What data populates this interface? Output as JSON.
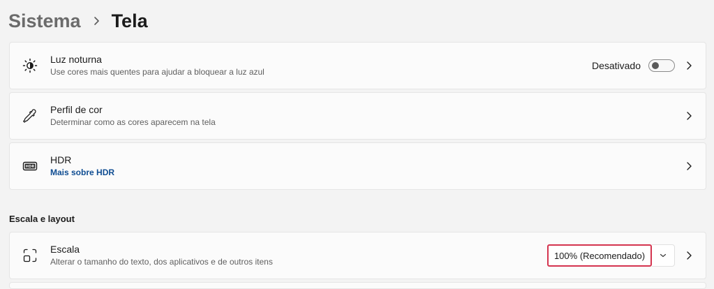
{
  "breadcrumb": {
    "parent": "Sistema",
    "current": "Tela"
  },
  "cards": {
    "night_light": {
      "title": "Luz noturna",
      "subtitle": "Use cores mais quentes para ajudar a bloquear a luz azul",
      "status": "Desativado",
      "toggle_on": false,
      "icon": "brightness-moon-icon"
    },
    "color_profile": {
      "title": "Perfil de cor",
      "subtitle": "Determinar como as cores aparecem na tela",
      "icon": "eyedropper-icon"
    },
    "hdr": {
      "title": "HDR",
      "link": "Mais sobre HDR",
      "icon": "hdr-icon"
    }
  },
  "section": {
    "title": "Escala e layout"
  },
  "scale": {
    "title": "Escala",
    "subtitle": "Alterar o tamanho do texto, dos aplicativos e de outros itens",
    "selected_value": "100% (Recomendado)",
    "icon": "scale-icon"
  },
  "colors": {
    "background": "#f3f3f3",
    "card": "#fbfbfb",
    "link": "#0f4d92",
    "highlight": "#d4344f"
  }
}
